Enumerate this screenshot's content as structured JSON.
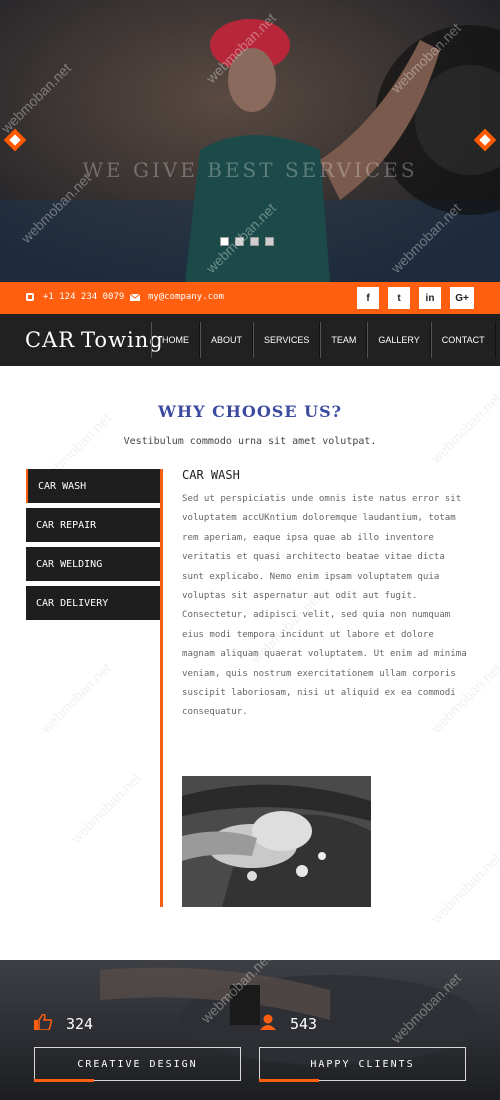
{
  "hero": {
    "tagline": "WE GIVE BEST SERVICES",
    "slides": 4,
    "active_slide": 1
  },
  "contact": {
    "phone": "+1 124 234 0079",
    "email": "my@company.com"
  },
  "social": {
    "facebook": "f",
    "twitter": "t",
    "linkedin": "in",
    "googleplus": "G+"
  },
  "brand": {
    "part1": "CAR",
    "part2": "Towing"
  },
  "nav": {
    "items": [
      "HOME",
      "ABOUT",
      "SERVICES",
      "TEAM",
      "GALLERY",
      "CONTACT"
    ]
  },
  "why": {
    "title": "WHY CHOOSE US?",
    "subtitle": "Vestibulum commodo urna sit amet volutpat.",
    "tabs": [
      "CAR WASH",
      "CAR REPAIR",
      "CAR WELDING",
      "CAR DELIVERY"
    ],
    "active_tab": "CAR WASH",
    "content_title": "CAR WASH",
    "paragraph1": "Sed ut perspiciatis unde omnis iste natus error sit voluptatem accUKntium doloremque laudantium, totam rem aperiam, eaque ipsa quae ab illo inventore veritatis et quasi architecto beatae vitae dicta sunt explicabo. Nemo enim ipsam voluptatem quia voluptas sit aspernatur aut odit aut fugit.",
    "paragraph2": "Consectetur, adipisci velit, sed quia non numquam eius modi tempora incidunt ut labore et dolore magnam aliquam quaerat voluptatem. Ut enim ad minima veniam, quis nostrum exercitationem ullam corporis suscipit laboriosam, nisi ut aliquid ex ea commodi consequatur."
  },
  "stats": {
    "likes": "324",
    "clients": "543",
    "box1": "CREATIVE DESIGN",
    "box2": "HAPPY CLIENTS"
  },
  "colors": {
    "accent": "#ff5f0f",
    "nav_bg": "#212121",
    "title_blue": "#3b4ba0"
  },
  "watermark": "webmoban.net"
}
